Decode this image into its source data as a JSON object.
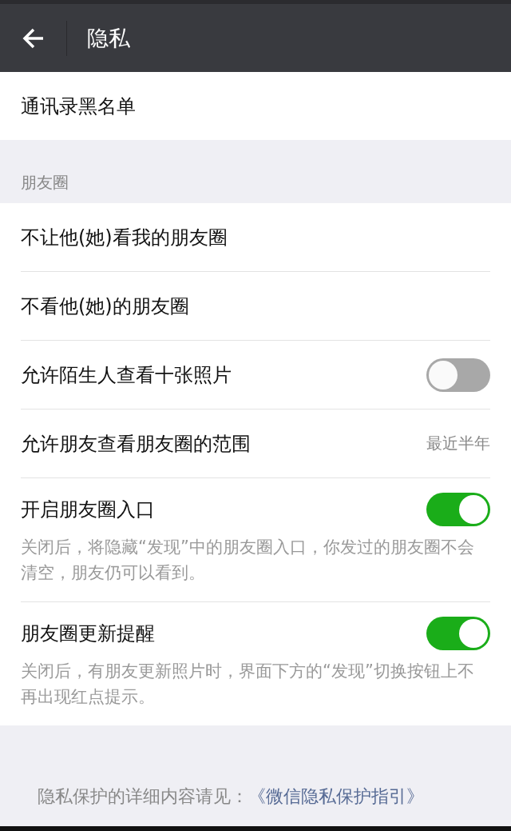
{
  "header": {
    "title": "隐私"
  },
  "blacklist": {
    "label": "通讯录黑名单"
  },
  "section": {
    "title": "朋友圈",
    "items": [
      {
        "kind": "link",
        "label": "不让他(她)看我的朋友圈"
      },
      {
        "kind": "link",
        "label": "不看他(她)的朋友圈"
      },
      {
        "kind": "toggle",
        "label": "允许陌生人查看十张照片",
        "on": false
      },
      {
        "kind": "value",
        "label": "允许朋友查看朋友圈的范围",
        "value": "最近半年"
      },
      {
        "kind": "toggle",
        "label": "开启朋友圈入口",
        "on": true,
        "description": "关闭后，将隐藏“发现”中的朋友圈入口，你发过的朋友圈不会清空，朋友仍可以看到。"
      },
      {
        "kind": "toggle",
        "label": "朋友圈更新提醒",
        "on": true,
        "description": "关闭后，有朋友更新照片时，界面下方的“发现”切换按钮上不再出现红点提示。"
      }
    ]
  },
  "footer": {
    "text": "隐私保护的详细内容请见：",
    "link": "《微信隐私保护指引》"
  }
}
